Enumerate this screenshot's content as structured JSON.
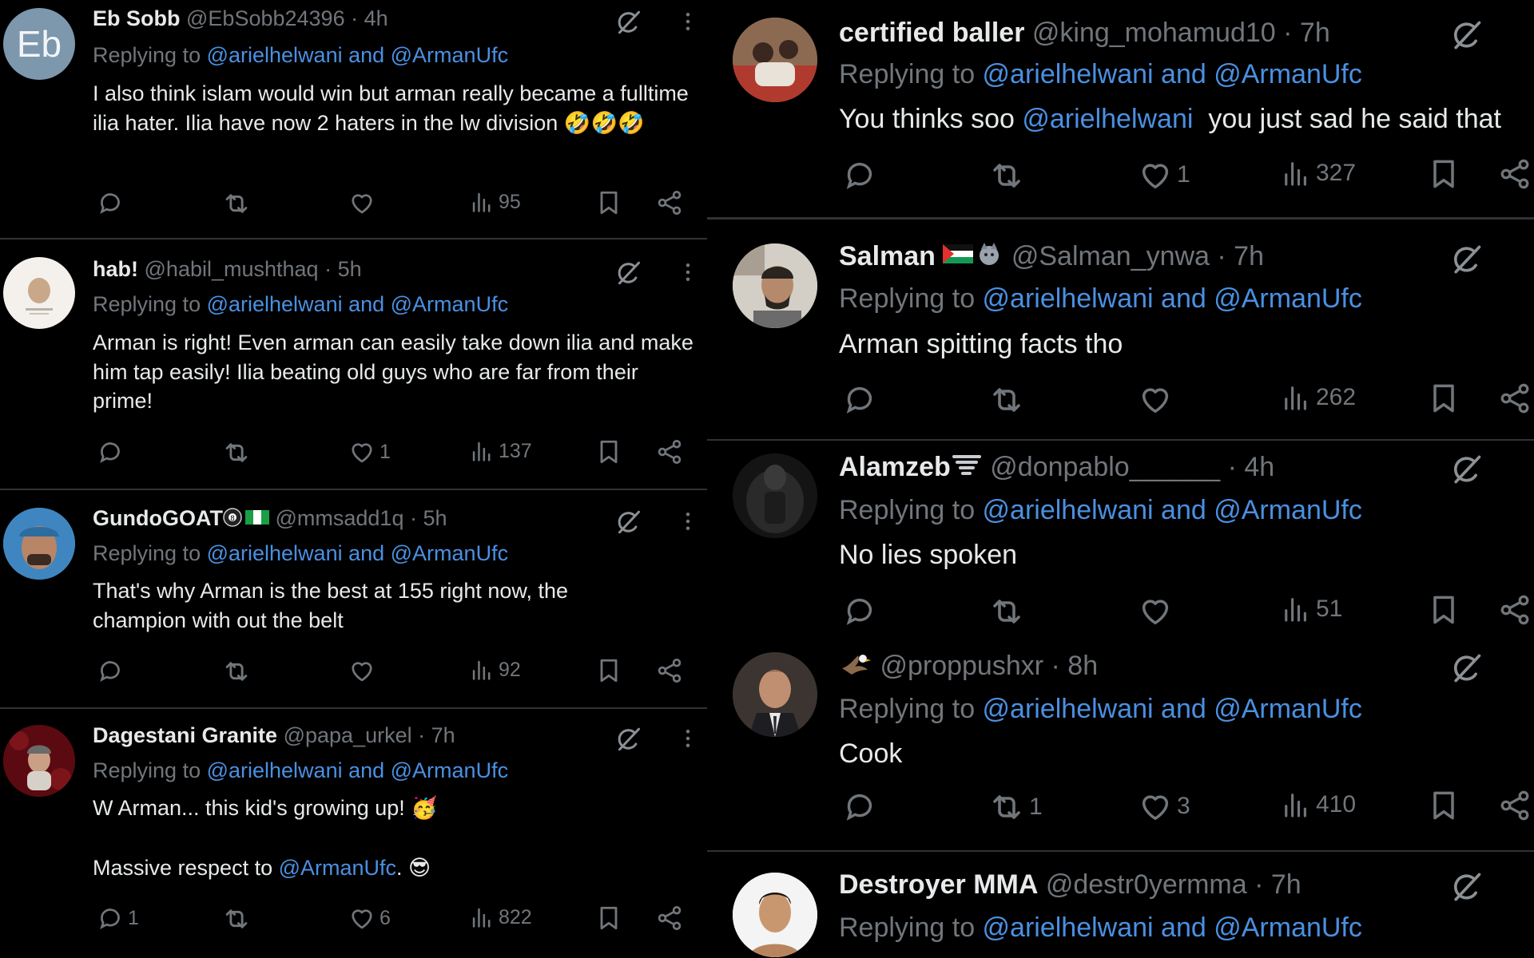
{
  "reply_prefix": "Replying to ",
  "reply_targets": "@arielhelwani and @ArmanUfc",
  "left_tweets": [
    {
      "avatar_initials": "Eb",
      "name": "Eb Sobb",
      "handle": "@EbSobb24396",
      "time": "· 4h",
      "text": "I also think islam would win but arman really became a fulltime ilia hater. Ilia have now 2 haters in the lw division 🤣🤣🤣",
      "replies": "",
      "reposts": "",
      "likes": "",
      "views": "95"
    },
    {
      "name": "hab!",
      "handle": "@habil_mushthaq",
      "time": "· 5h",
      "text": "Arman is right! Even arman can easily take down ilia and make him tap easily! Ilia beating old guys who are far from their prime!",
      "replies": "",
      "reposts": "",
      "likes": "1",
      "views": "137"
    },
    {
      "name": "GundoGOAT",
      "handle": "@mmsadd1q",
      "time": "· 5h",
      "text": "That's why Arman is the best at 155 right now, the champion with out the belt",
      "replies": "",
      "reposts": "",
      "likes": "",
      "views": "92"
    },
    {
      "name": "Dagestani Granite",
      "handle": "@papa_urkel",
      "time": "· 7h",
      "text_line1": "W Arman... this kid's growing up! 🥳",
      "text_line2_before": "Massive respect to ",
      "text_line2_mention": "@ArmanUfc",
      "text_line2_after": ". 😎",
      "replies": "1",
      "reposts": "",
      "likes": "6",
      "views": "822"
    }
  ],
  "right_tweets": [
    {
      "name": "certified baller",
      "handle": "@king_mohamud10",
      "time": "· 7h",
      "text_before": "You thinks soo ",
      "text_mention": "@arielhelwani",
      "text_after": "  you just sad he said that",
      "replies": "",
      "reposts": "",
      "likes": "1",
      "views": "327"
    },
    {
      "name": "Salman",
      "name_emojis": "🇵🇸🐺",
      "handle": "@Salman_ynwa",
      "time": "· 7h",
      "text": "Arman spitting facts tho",
      "replies": "",
      "reposts": "",
      "likes": "",
      "views": "262"
    },
    {
      "name": "Alamzeb",
      "name_emojis": "🌪️",
      "handle": "@donpablo______",
      "time": "· 4h",
      "text": "No lies spoken",
      "replies": "",
      "reposts": "",
      "likes": "",
      "views": "51"
    },
    {
      "name_emojis": "🦅",
      "handle": "@proppushxr",
      "time": "· 8h",
      "text": "Cook",
      "replies": "",
      "reposts": "1",
      "likes": "3",
      "views": "410"
    },
    {
      "name": "Destroyer MMA",
      "handle": "@destr0yermma",
      "time": "· 7h"
    }
  ],
  "icons": {
    "reply": "reply-icon",
    "repost": "repost-icon",
    "like": "heart-icon",
    "views": "views-icon",
    "bookmark": "bookmark-icon",
    "share": "share-icon",
    "grok": "grok-icon",
    "more": "more-icon"
  },
  "colors": {
    "background": "#000000",
    "text": "#e7e9ea",
    "muted": "#71767b",
    "mention": "#4a90e2",
    "divider": "#2f3336"
  }
}
